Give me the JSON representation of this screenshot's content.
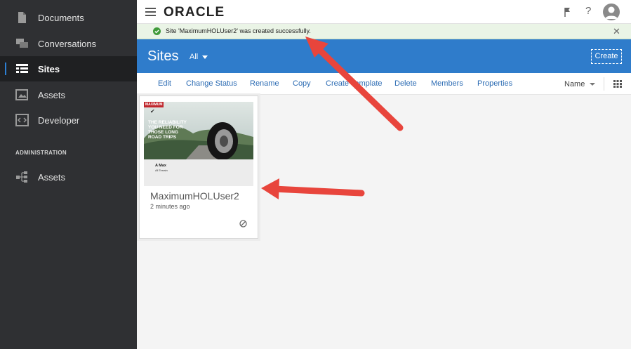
{
  "sidebar": {
    "items": [
      {
        "label": "Documents",
        "icon": "document-icon"
      },
      {
        "label": "Conversations",
        "icon": "conversations-icon"
      },
      {
        "label": "Sites",
        "icon": "sites-icon"
      },
      {
        "label": "Assets",
        "icon": "assets-icon"
      },
      {
        "label": "Developer",
        "icon": "developer-icon"
      }
    ],
    "admin_heading": "ADMINISTRATION",
    "admin_items": [
      {
        "label": "Assets",
        "icon": "admin-assets-icon"
      }
    ]
  },
  "topbar": {
    "logo": "ORACLE",
    "help": "?"
  },
  "notification": {
    "message": "Site 'MaximumHOLUser2' was created successfully.",
    "close": "✕"
  },
  "header": {
    "title": "Sites",
    "filter": "All",
    "create_label": "Create"
  },
  "toolbar": {
    "actions": [
      "Edit",
      "Change Status",
      "Rename",
      "Copy",
      "Create Template",
      "Delete",
      "Members",
      "Properties"
    ],
    "sort_label": "Name"
  },
  "site_card": {
    "name": "MaximumHOLUser2",
    "time": "2 minutes ago",
    "thumbnail": {
      "badge": "MAXIMUM",
      "headline": "THE RELIABILITY YOU NEED FOR THOSE LONG ROAD TRIPS",
      "product": "A Max",
      "subtitle": "All Terrain"
    }
  },
  "colors": {
    "sidebar": "#2f3033",
    "header_blue": "#2f7ccb",
    "link_blue": "#2b6bb3",
    "success_bg": "#eaf4e6",
    "arrow_red": "#e8453c"
  }
}
